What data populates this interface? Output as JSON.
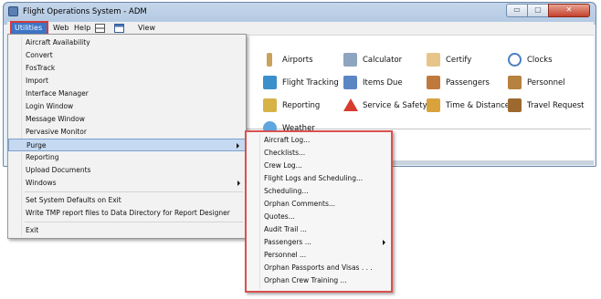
{
  "window": {
    "title": "Flight Operations System - ADM",
    "minimize_label": "▭",
    "maximize_label": "▢",
    "close_label": "✕"
  },
  "menubar": {
    "utilities": "Utilities",
    "web": "Web",
    "help": "Help",
    "view": "View"
  },
  "tiles": [
    {
      "label": "Airports",
      "icon": "airport-icon",
      "color": "#c8a25a"
    },
    {
      "label": "Calculator",
      "icon": "calculator-icon",
      "color": "#8fa5bf"
    },
    {
      "label": "Certify",
      "icon": "certificate-icon",
      "color": "#e7c58a"
    },
    {
      "label": "Clocks",
      "icon": "clock-icon",
      "color": "#4a7fc0"
    },
    {
      "label": "Flight Tracking",
      "icon": "flight-tracking-icon",
      "color": "#3b8fcb"
    },
    {
      "label": "Items Due",
      "icon": "items-due-icon",
      "color": "#5b86c4"
    },
    {
      "label": "Passengers",
      "icon": "passengers-icon",
      "color": "#c0793d"
    },
    {
      "label": "Personnel",
      "icon": "personnel-icon",
      "color": "#b7813f"
    },
    {
      "label": "Reporting",
      "icon": "reporting-icon",
      "color": "#d7b246"
    },
    {
      "label": "Service & Safety",
      "icon": "warning-icon",
      "color": "#d73a2e"
    },
    {
      "label": "Time & Distance",
      "icon": "signpost-icon",
      "color": "#d9a23c"
    },
    {
      "label": "Travel Request",
      "icon": "travel-request-icon",
      "color": "#9c6a2f"
    },
    {
      "label": "Weather",
      "icon": "weather-icon",
      "color": "#5fa6e0"
    }
  ],
  "utilities_menu": {
    "items": [
      {
        "label": "Aircraft Availability"
      },
      {
        "label": "Convert"
      },
      {
        "label": "FosTrack"
      },
      {
        "label": "Import"
      },
      {
        "label": "Interface Manager"
      },
      {
        "label": "Login Window"
      },
      {
        "label": "Message Window"
      },
      {
        "label": "Pervasive Monitor"
      },
      {
        "label": "Purge"
      },
      {
        "label": "Reporting"
      },
      {
        "label": "Upload Documents"
      },
      {
        "label": "Windows"
      },
      {
        "label": "Set System Defaults on Exit"
      },
      {
        "label": "Write TMP report files to Data Directory for Report Designer"
      },
      {
        "label": "Exit"
      }
    ]
  },
  "purge_menu": {
    "items": [
      {
        "label": "Aircraft Log..."
      },
      {
        "label": "Checklists..."
      },
      {
        "label": "Crew Log..."
      },
      {
        "label": "Flight Logs and Scheduling..."
      },
      {
        "label": "Scheduling..."
      },
      {
        "label": "Orphan Comments..."
      },
      {
        "label": "Quotes..."
      },
      {
        "label": "Audit Trail ..."
      },
      {
        "label": "Passengers ..."
      },
      {
        "label": "Personnel ..."
      },
      {
        "label": "Orphan Passports and Visas . . ."
      },
      {
        "label": "Orphan Crew Training ..."
      }
    ]
  },
  "colors": {
    "highlight": "#3c75c6",
    "callout_border": "#d9514f",
    "menu_hover": "#c5d9f1"
  }
}
